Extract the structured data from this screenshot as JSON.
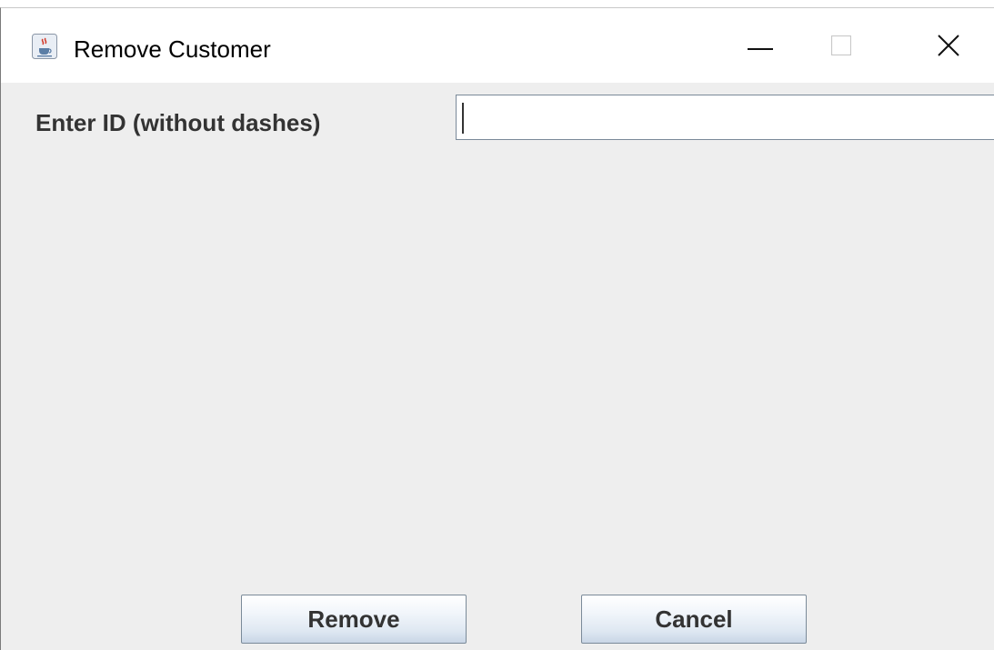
{
  "window": {
    "title": "Remove Customer",
    "app_icon": "java-cup-icon",
    "controls": {
      "minimize_icon": "minimize-icon",
      "maximize_icon": "maximize-icon",
      "close_icon": "close-icon"
    }
  },
  "form": {
    "id_label": "Enter ID (without dashes)",
    "id_value": "",
    "id_placeholder": ""
  },
  "buttons": {
    "remove_label": "Remove",
    "cancel_label": "Cancel"
  },
  "colors": {
    "panel_background": "#eeeeee",
    "titlebar_background": "#ffffff",
    "button_border": "#7a8a99",
    "label_text": "#333333"
  }
}
